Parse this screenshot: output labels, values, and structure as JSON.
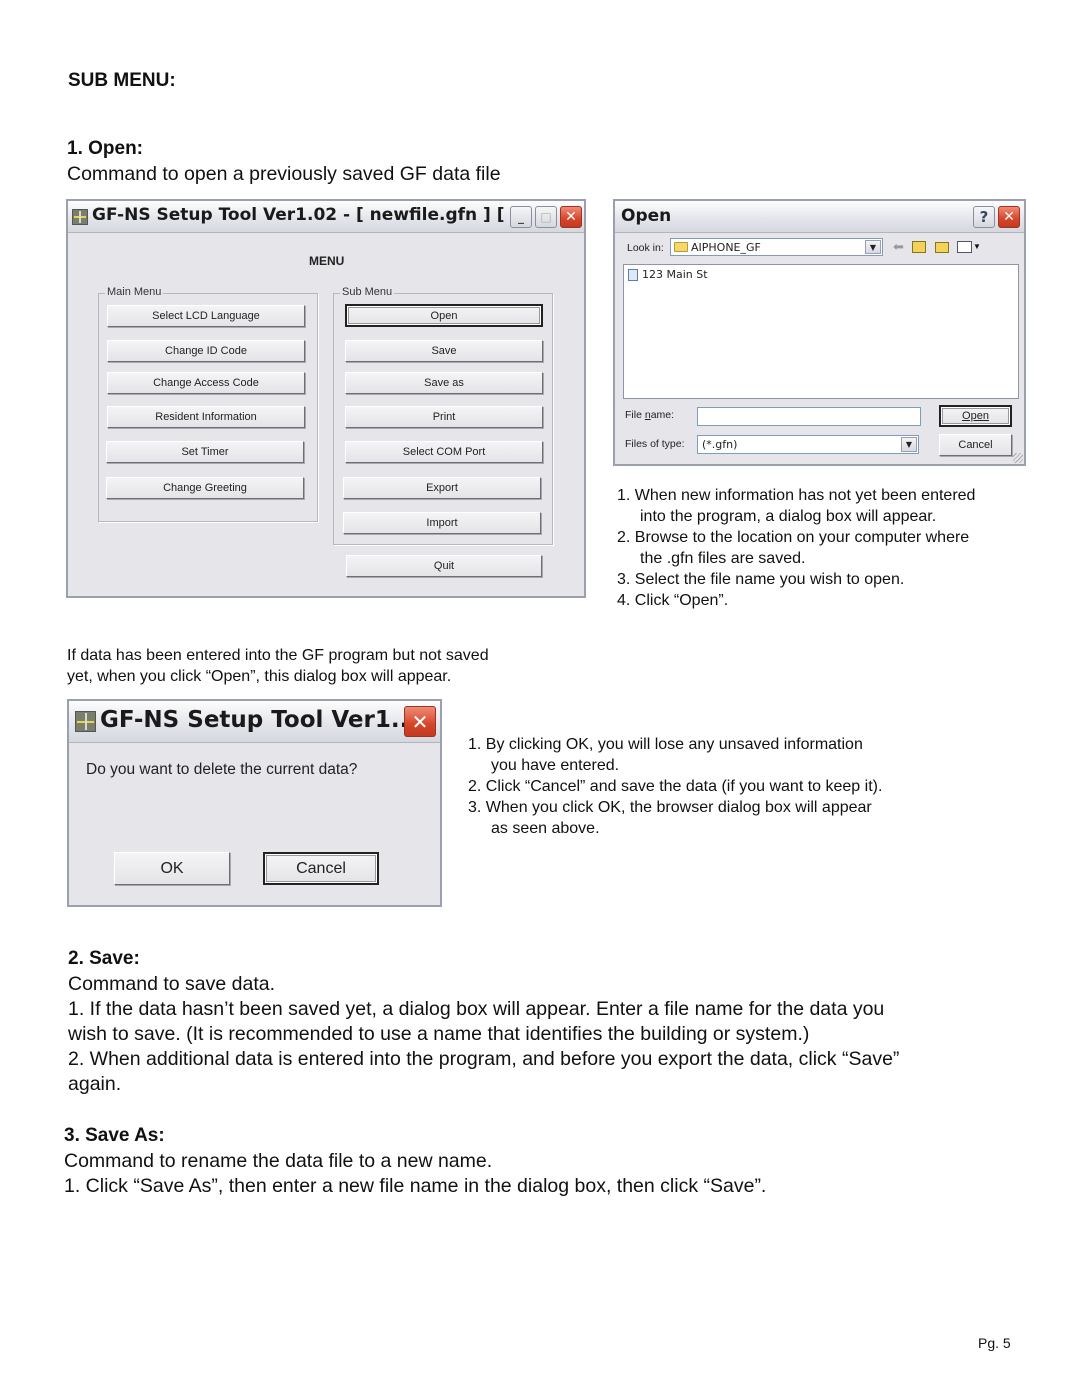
{
  "heading": "SUB MENU:",
  "open_section": {
    "title": "1. Open:",
    "description": "Command to open a previously saved GF data file"
  },
  "main_window": {
    "title": "GF-NS Setup Tool Ver1.02   - [ newfile.gfn ] [ ...",
    "menu_label": "MENU",
    "main_menu_label": "Main Menu",
    "sub_menu_label": "Sub Menu",
    "main_menu_buttons": [
      "Select LCD Language",
      "Change ID Code",
      "Change Access Code",
      "Resident Information",
      "Set Timer",
      "Change Greeting"
    ],
    "sub_menu_buttons": [
      "Open",
      "Save",
      "Save as",
      "Print",
      "Select COM Port",
      "Export",
      "Import"
    ],
    "quit_label": "Quit",
    "minimize_glyph": "_",
    "maximize_glyph": "□",
    "close_glyph": "✕"
  },
  "open_dialog": {
    "title": "Open",
    "help_glyph": "?",
    "close_glyph": "✕",
    "look_in_label": "Look in:",
    "look_in_value": "AIPHONE_GF",
    "files": [
      "123 Main St"
    ],
    "file_name_label": "File name:",
    "file_name_value": "",
    "files_of_type_label": "Files of type:",
    "files_of_type_value": "(*.gfn)",
    "open_button": "Open",
    "cancel_button": "Cancel",
    "toolbar_icons": [
      "back-icon",
      "up-folder-icon",
      "new-folder-icon",
      "view-menu-icon"
    ]
  },
  "open_steps": [
    "1. When new information has not yet been entered",
    "into the program, a dialog box will appear.",
    "2. Browse to the location on your computer where",
    "the .gfn files are saved.",
    "3. Select the file name you wish to open.",
    "4. Click “Open”."
  ],
  "unsaved_note": [
    "If data has been entered into the GF program but not saved",
    "yet, when you click “Open”, this dialog box will appear."
  ],
  "confirm_dialog": {
    "title": "GF-NS Setup Tool Ver1...",
    "message": "Do you want to delete the current data?",
    "ok_button": "OK",
    "cancel_button": "Cancel",
    "close_glyph": "✕"
  },
  "confirm_steps": [
    "1. By clicking OK, you will lose any unsaved information",
    "you have entered.",
    "2. Click “Cancel” and save the data (if you want to keep it).",
    "3. When you click OK, the browser dialog box will appear",
    "as seen above."
  ],
  "save_section": {
    "title": "2. Save:",
    "lines": [
      "Command to save data.",
      "1. If the data hasn’t been saved yet, a dialog box will appear. Enter a file name for the data you",
      "wish to save. (It is recommended to use a name that identifies the building or system.)",
      "2. When additional data is entered into the program, and before you export the data, click “Save”",
      "again."
    ]
  },
  "save_as_section": {
    "title": "3. Save As:",
    "lines": [
      "Command to rename the data file to a new name.",
      "1. Click “Save As”, then enter a new file name in the dialog box, then click “Save”."
    ]
  },
  "page_number": "Pg. 5"
}
